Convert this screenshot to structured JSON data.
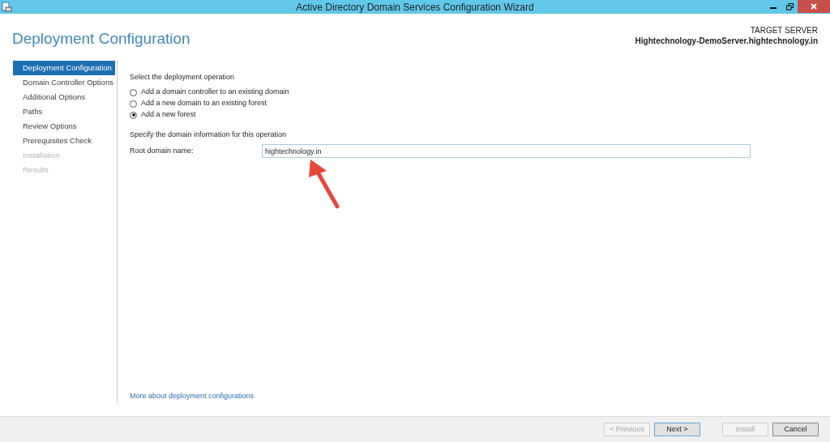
{
  "window": {
    "title": "Active Directory Domain Services Configuration Wizard"
  },
  "page_title": "Deployment Configuration",
  "target_server": {
    "label": "TARGET SERVER",
    "name": "Hightechnology-DemoServer.hightechnology.in"
  },
  "sidebar": {
    "items": [
      {
        "label": "Deployment Configuration",
        "selected": true,
        "disabled": false
      },
      {
        "label": "Domain Controller Options",
        "selected": false,
        "disabled": false
      },
      {
        "label": "Additional Options",
        "selected": false,
        "disabled": false
      },
      {
        "label": "Paths",
        "selected": false,
        "disabled": false
      },
      {
        "label": "Review Options",
        "selected": false,
        "disabled": false
      },
      {
        "label": "Prerequisites Check",
        "selected": false,
        "disabled": false
      },
      {
        "label": "Installation",
        "selected": false,
        "disabled": true
      },
      {
        "label": "Results",
        "selected": false,
        "disabled": true
      }
    ]
  },
  "operation": {
    "heading": "Select the deployment operation",
    "options": [
      {
        "label": "Add a domain controller to an existing domain",
        "selected": false
      },
      {
        "label": "Add a new domain to an existing forest",
        "selected": false
      },
      {
        "label": "Add a new forest",
        "selected": true
      }
    ]
  },
  "domain_info": {
    "heading": "Specify the domain information for this operation",
    "field_label": "Root domain name:",
    "value": "hightechnology.in"
  },
  "more_link": "More about deployment configurations",
  "buttons": [
    {
      "label": "< Previous",
      "disabled": true,
      "default": false
    },
    {
      "label": "Next >",
      "disabled": false,
      "default": true
    },
    {
      "label": "Install",
      "disabled": true,
      "default": false
    },
    {
      "label": "Cancel",
      "disabled": false,
      "default": false
    }
  ]
}
